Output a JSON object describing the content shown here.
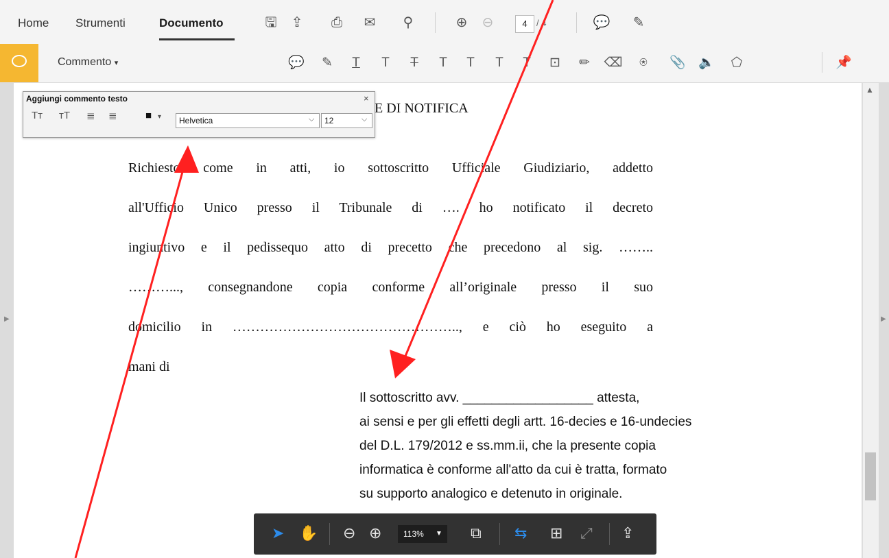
{
  "topnav": {
    "home": "Home",
    "tools": "Strumenti",
    "document": "Documento"
  },
  "pager": {
    "current": "4",
    "total": "/ 4"
  },
  "comment_bar": {
    "label": "Commento"
  },
  "text_panel": {
    "title": "Aggiungi commento testo",
    "close": "×",
    "font": "Helvetica",
    "size": "12"
  },
  "document": {
    "title_fragment": "E DI NOTIFICA",
    "lines": [
      "Richiesto come in atti, io sottoscritto Ufficiale Giudiziario, addetto",
      "all'Ufficio Unico presso il Tribunale di …. ho notificato il decreto",
      "ingiuntivo e il pedissequo atto di precetto che precedono al sig. ……..",
      "………..., consegnandone copia conforme all’originale presso il suo",
      "domicilio in ………………………………………….., e ciò ho eseguito a",
      "mani di"
    ],
    "attestation": [
      "Il sottoscritto avv. __________________ attesta,",
      "ai sensi e per gli effetti degli artt. 16-decies e 16-undecies",
      "del D.L. 179/2012 e ss.mm.ii, che la presente  copia",
      "informatica è conforme all'atto da cui è tratta, formato",
      "su supporto analogico e detenuto in originale."
    ]
  },
  "floating_toolbar": {
    "zoom": "113%"
  },
  "colors": {
    "accent": "#f5b731",
    "arrow": "#ff2020",
    "active_icon": "#2d8ceb"
  }
}
